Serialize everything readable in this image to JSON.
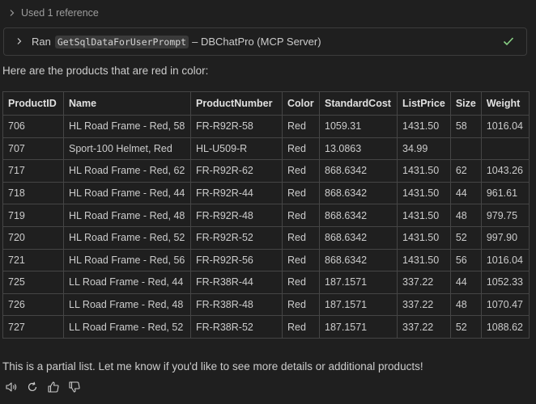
{
  "references": {
    "label": "Used 1 reference"
  },
  "tool_call": {
    "prefix": "Ran",
    "tool_name": "GetSqlDataForUserPrompt",
    "suffix": "– DBChatPro (MCP Server)",
    "status_color": "#89d185"
  },
  "message": {
    "intro": "Here are the products that are red in color:",
    "outro": "This is a partial list. Let me know if you'd like to see more details or additional products!"
  },
  "table": {
    "columns": [
      "ProductID",
      "Name",
      "ProductNumber",
      "Color",
      "StandardCost",
      "ListPrice",
      "Size",
      "Weight"
    ],
    "rows": [
      [
        "706",
        "HL Road Frame - Red, 58",
        "FR-R92R-58",
        "Red",
        "1059.31",
        "1431.50",
        "58",
        "1016.04"
      ],
      [
        "707",
        "Sport-100 Helmet, Red",
        "HL-U509-R",
        "Red",
        "13.0863",
        "34.99",
        "",
        ""
      ],
      [
        "717",
        "HL Road Frame - Red, 62",
        "FR-R92R-62",
        "Red",
        "868.6342",
        "1431.50",
        "62",
        "1043.26"
      ],
      [
        "718",
        "HL Road Frame - Red, 44",
        "FR-R92R-44",
        "Red",
        "868.6342",
        "1431.50",
        "44",
        "961.61"
      ],
      [
        "719",
        "HL Road Frame - Red, 48",
        "FR-R92R-48",
        "Red",
        "868.6342",
        "1431.50",
        "48",
        "979.75"
      ],
      [
        "720",
        "HL Road Frame - Red, 52",
        "FR-R92R-52",
        "Red",
        "868.6342",
        "1431.50",
        "52",
        "997.90"
      ],
      [
        "721",
        "HL Road Frame - Red, 56",
        "FR-R92R-56",
        "Red",
        "868.6342",
        "1431.50",
        "56",
        "1016.04"
      ],
      [
        "725",
        "LL Road Frame - Red, 44",
        "FR-R38R-44",
        "Red",
        "187.1571",
        "337.22",
        "44",
        "1052.33"
      ],
      [
        "726",
        "LL Road Frame - Red, 48",
        "FR-R38R-48",
        "Red",
        "187.1571",
        "337.22",
        "48",
        "1070.47"
      ],
      [
        "727",
        "LL Road Frame - Red, 52",
        "FR-R38R-52",
        "Red",
        "187.1571",
        "337.22",
        "52",
        "1088.62"
      ]
    ]
  },
  "actions": {
    "icons": [
      "speaker-icon",
      "retry-icon",
      "thumbs-up-icon",
      "thumbs-down-icon"
    ]
  }
}
